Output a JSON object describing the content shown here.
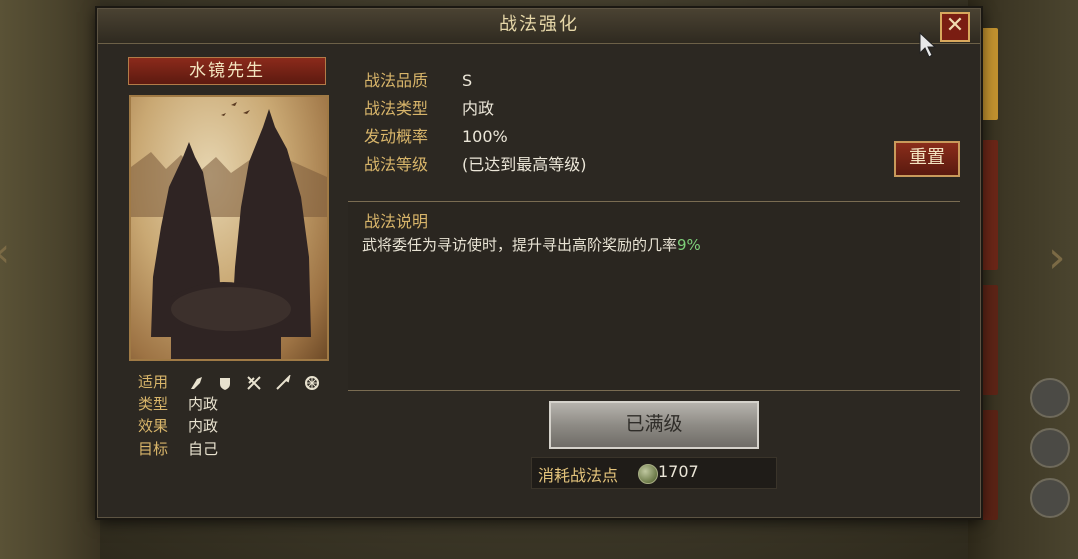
{
  "dialog": {
    "title": "战法强化",
    "close_label": "✕"
  },
  "skill": {
    "name": "水镜先生"
  },
  "attributes": [
    {
      "label": "适用",
      "value": ""
    },
    {
      "label": "类型",
      "value": "内政"
    },
    {
      "label": "效果",
      "value": "内政"
    },
    {
      "label": "目标",
      "value": "自己"
    }
  ],
  "applicable_icons": [
    "axe-icon",
    "shield-icon",
    "crossbow-icon",
    "spear-icon",
    "wheel-icon"
  ],
  "info": [
    {
      "label": "战法品质",
      "value": "S"
    },
    {
      "label": "战法类型",
      "value": "内政"
    },
    {
      "label": "发动概率",
      "value": "100%"
    },
    {
      "label": "战法等级",
      "value": "(已达到最高等级)"
    }
  ],
  "reset_label": "重置",
  "description": {
    "title": "战法说明",
    "text": "武将委任为寻访使时，提升寻出高阶奖励的几率",
    "highlight": "9%"
  },
  "maxed_label": "已满级",
  "cost": {
    "label": "消耗战法点",
    "value": "1707"
  },
  "colors": {
    "gold_label": "#d8b56a",
    "highlight_green": "#7ed07a",
    "red_button": "#8a2d1b"
  }
}
